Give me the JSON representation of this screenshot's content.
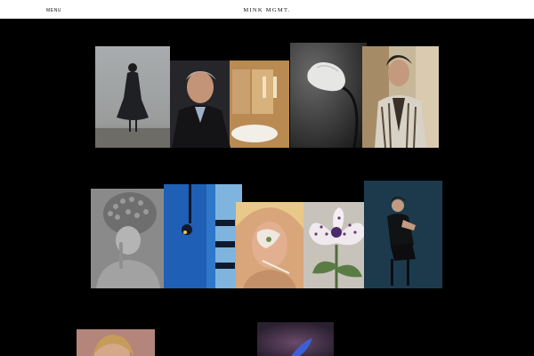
{
  "header": {
    "menu_label": "MENU",
    "brand": "MINK MGMT."
  },
  "colors": {
    "page_background": "#000000",
    "header_background": "#ffffff"
  },
  "gallery": {
    "tiles": [
      {
        "name": "tile-figure-in-fog",
        "desc_icon": "photo-icon"
      },
      {
        "name": "tile-man-restaurant",
        "desc_icon": "photo-icon"
      },
      {
        "name": "tile-tulip",
        "desc_icon": "photo-icon"
      },
      {
        "name": "tile-young-man-jacket",
        "desc_icon": "photo-icon"
      },
      {
        "name": "tile-knit-hat-portrait",
        "desc_icon": "photo-icon"
      },
      {
        "name": "tile-blue-architecture",
        "desc_icon": "photo-icon"
      },
      {
        "name": "tile-woman-face-flower",
        "desc_icon": "photo-icon"
      },
      {
        "name": "tile-spotted-lily",
        "desc_icon": "photo-icon"
      },
      {
        "name": "tile-seated-woman",
        "desc_icon": "photo-icon"
      },
      {
        "name": "tile-blonde-portrait-partial",
        "desc_icon": "photo-icon"
      },
      {
        "name": "tile-blurred-partial",
        "desc_icon": "photo-icon"
      }
    ]
  }
}
